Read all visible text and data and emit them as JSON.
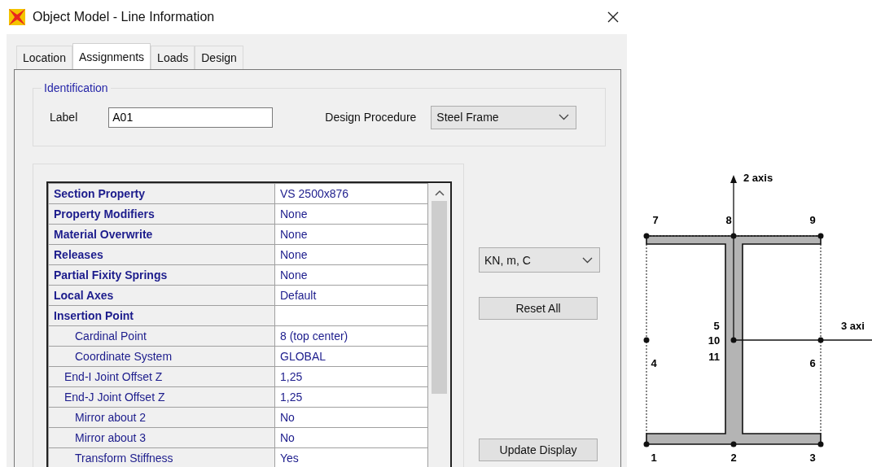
{
  "window": {
    "title": "Object Model - Line Information"
  },
  "tabs": [
    {
      "label": "Location",
      "selected": false
    },
    {
      "label": "Assignments",
      "selected": true
    },
    {
      "label": "Loads",
      "selected": false
    },
    {
      "label": "Design",
      "selected": false
    }
  ],
  "identification": {
    "legend": "Identification",
    "label_caption": "Label",
    "label_value": "A01",
    "procedure_caption": "Design Procedure",
    "procedure_value": "Steel Frame"
  },
  "properties": [
    {
      "kind": "heading",
      "name": "Section Property",
      "value": "VS 2500x876"
    },
    {
      "kind": "heading",
      "name": "Property Modifiers",
      "value": "None"
    },
    {
      "kind": "heading",
      "name": "Material Overwrite",
      "value": "None"
    },
    {
      "kind": "heading",
      "name": "Releases",
      "value": "None"
    },
    {
      "kind": "heading",
      "name": "Partial Fixity Springs",
      "value": "None"
    },
    {
      "kind": "heading",
      "name": "Local Axes",
      "value": "Default"
    },
    {
      "kind": "heading",
      "name": "Insertion Point"
    },
    {
      "kind": "subfield",
      "name": "Cardinal Point",
      "value": "8 (top center)"
    },
    {
      "kind": "subfield",
      "name": "Coordinate System",
      "value": "GLOBAL"
    },
    {
      "kind": "field",
      "name": "End-I Joint Offset Z",
      "value": "1,25"
    },
    {
      "kind": "field",
      "name": "End-J Joint Offset Z",
      "value": "1,25"
    },
    {
      "kind": "subfield",
      "name": "Mirror about 2",
      "value": "No"
    },
    {
      "kind": "subfield",
      "name": "Mirror about 3",
      "value": "No"
    },
    {
      "kind": "subfield",
      "name": "Transform Stiffness",
      "value": "Yes"
    }
  ],
  "units": "KN, m, C",
  "buttons": [
    "Reset All",
    "Update Display"
  ],
  "diagram": {
    "axis_labels": [
      "2 axis",
      "3 axi"
    ],
    "point_labels": [
      "1",
      "2",
      "3",
      "4",
      "5",
      "6",
      "7",
      "8",
      "9",
      "10",
      "11"
    ]
  }
}
